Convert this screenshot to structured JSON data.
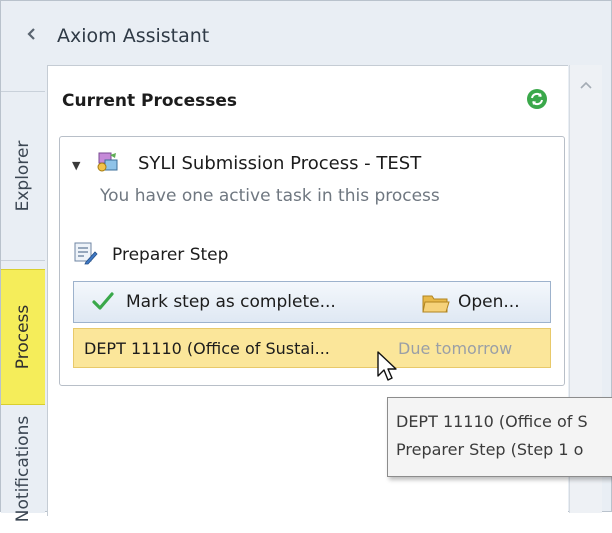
{
  "header": {
    "title": "Axiom Assistant",
    "collapse_icon": "chevron-left-icon"
  },
  "tabs": [
    {
      "label": "Explorer"
    },
    {
      "label": "Process",
      "active": true
    },
    {
      "label": "Notifications"
    }
  ],
  "panel": {
    "title": "Current Processes",
    "refresh_icon": "refresh-icon"
  },
  "process": {
    "name": "SYLI Submission Process - TEST",
    "subtitle": "You have one active task in this process",
    "icon": "process-icon"
  },
  "step": {
    "name": "Preparer Step",
    "icon": "form-edit-icon",
    "mark_complete_label": "Mark step as complete...",
    "open_label": "Open..."
  },
  "task": {
    "name": "DEPT 11110 (Office of Sustai...",
    "due": "Due tomorrow"
  },
  "tooltip": {
    "line1": "DEPT 11110 (Office of S",
    "line2": "Preparer Step (Step 1 o"
  },
  "colors": {
    "active_tab": "#f5ed5a",
    "task_highlight": "#fbe69a",
    "refresh": "#3aa84a",
    "check": "#3aa84a"
  }
}
